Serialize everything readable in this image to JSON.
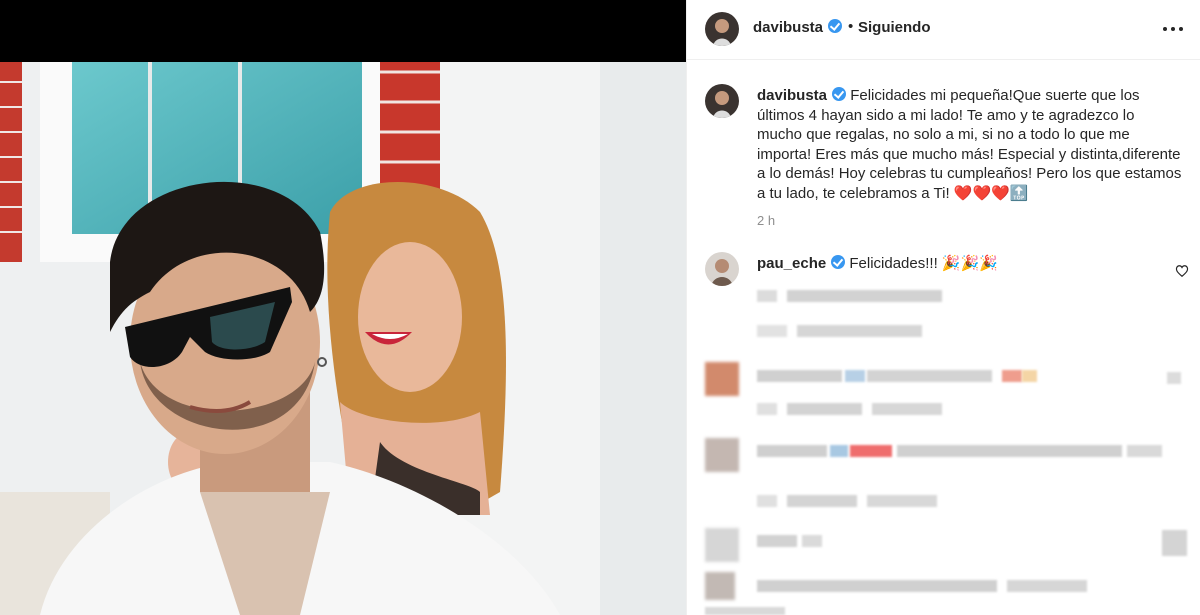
{
  "post": {
    "username": "davibusta",
    "dot": "•",
    "follow_label": "Siguiendo",
    "more_icon": "more-options-icon"
  },
  "caption": {
    "username": "davibusta",
    "text": "Felicidades mi pequeña!Que suerte que los últimos 4 hayan sido a mi lado! Te amo y te agradezco lo mucho que regalas, no solo a mi, si no a todo lo que me importa! Eres más que mucho más! Especial y distinta,diferente a lo demás! Hoy celebras tu cumpleaños! Pero los que estamos a tu lado, te celebramos a Ti! ❤️❤️❤️🔝",
    "time": "2 h"
  },
  "comments": [
    {
      "username": "pau_eche",
      "text": "Felicidades!!! 🎉🎉🎉"
    }
  ],
  "colors": {
    "verified": "#3897f0",
    "text": "#262626",
    "muted": "#8e8e8e",
    "divider": "#efefef"
  }
}
